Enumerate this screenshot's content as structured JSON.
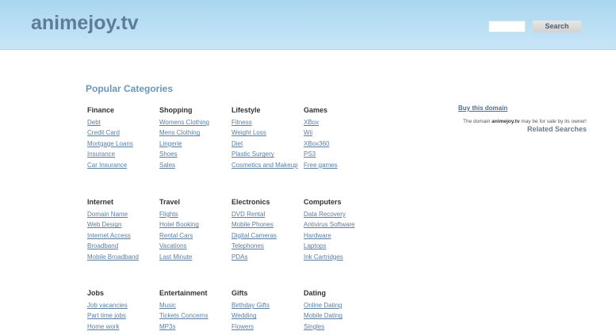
{
  "header": {
    "logo": "animejoy.tv",
    "search_placeholder": "",
    "search_button": "Search"
  },
  "main": {
    "popular_title": "Popular Categories",
    "categories": [
      {
        "title": "Finance",
        "links": [
          "Debt",
          "Credit Card",
          "Mortgage Loans",
          "Insurance",
          "Car Insurance"
        ]
      },
      {
        "title": "Shopping",
        "links": [
          "Womens Clothing",
          "Mens Clothing",
          "Lingerie",
          "Shoes",
          "Sales"
        ]
      },
      {
        "title": "Lifestyle",
        "links": [
          "Fitness",
          "Weight Loss",
          "Diet",
          "Plastic Surgery",
          "Cosmetics and Makeup"
        ]
      },
      {
        "title": "Games",
        "links": [
          "XBox",
          "Wii",
          "XBox360",
          "PS3",
          "Free games"
        ]
      },
      {
        "title": "Internet",
        "links": [
          "Domain Name",
          "Web Design",
          "Internet Access",
          "Broadband",
          "Mobile Broadband"
        ]
      },
      {
        "title": "Travel",
        "links": [
          "Flights",
          "Hotel Booking",
          "Rental Cars",
          "Vacations",
          "Last Minute"
        ]
      },
      {
        "title": "Electronics",
        "links": [
          "DVD Rental",
          "Mobile Phones",
          "Digital Cameras",
          "Telephones",
          "PDAs"
        ]
      },
      {
        "title": "Computers",
        "links": [
          "Data Recovery",
          "Antivirus Software",
          "Hardware",
          "Laptops",
          "Ink Cartridges"
        ]
      },
      {
        "title": "Jobs",
        "links": [
          "Job vacancies",
          "Part time jobs",
          "Home work"
        ]
      },
      {
        "title": "Entertainment",
        "links": [
          "Music",
          "Tickets Concerns",
          "MP3s"
        ]
      },
      {
        "title": "Gifts",
        "links": [
          "Birthday Gifts",
          "Wedding",
          "Flowers"
        ]
      },
      {
        "title": "Dating",
        "links": [
          "Online Dating",
          "Mobile Dating",
          "Singles"
        ]
      }
    ]
  },
  "sidebar": {
    "buy_domain": "Buy this domain",
    "sale_prefix": "The domain ",
    "sale_domain": "animejoy.tv",
    "sale_suffix": " may be for sale by its owner!",
    "related_searches": "Related Searches"
  }
}
